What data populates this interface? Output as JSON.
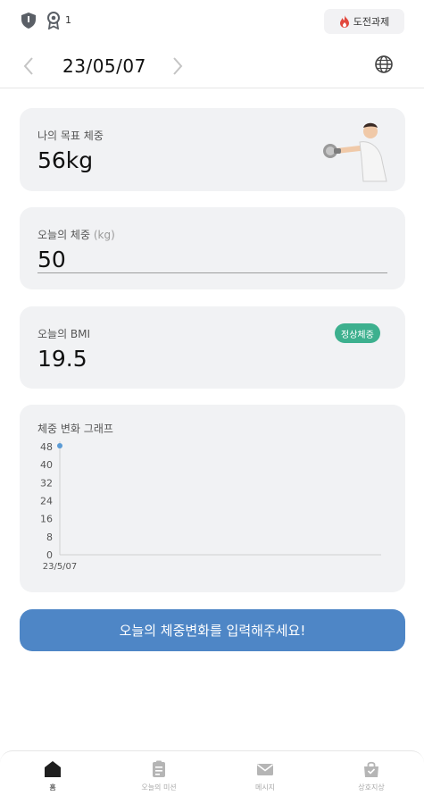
{
  "status_bar": {
    "badge_count": "1",
    "challenge_label": "도전과제"
  },
  "date_nav": {
    "date": "23/05/07"
  },
  "goal_card": {
    "label": "나의 목표 체중",
    "value": "56kg"
  },
  "weight_card": {
    "label": "오늘의 체중",
    "unit": "(kg)",
    "value": "50"
  },
  "bmi_card": {
    "label": "오늘의 BMI",
    "value": "19.5",
    "status": "정상체중"
  },
  "chart_card": {
    "label": "체중 변화 그래프"
  },
  "chart_data": {
    "type": "line",
    "title": "체중 변화 그래프",
    "x": [
      "23/5/07"
    ],
    "series": [
      {
        "values": [
          50
        ]
      }
    ],
    "ylim": [
      0,
      48
    ],
    "yticks": [
      "48",
      "40",
      "32",
      "24",
      "16",
      "8",
      "0"
    ],
    "color": "#5b9bd5"
  },
  "cta": {
    "label": "오늘의 체중변화를 입력해주세요!"
  },
  "tabs": [
    {
      "label": "홈",
      "icon": "home-icon",
      "active": true
    },
    {
      "label": "오늘의 미션",
      "icon": "clipboard-icon",
      "active": false
    },
    {
      "label": "메시지",
      "icon": "mail-icon",
      "active": false
    },
    {
      "label": "상호지상",
      "icon": "bag-icon",
      "active": false
    }
  ],
  "colors": {
    "accent": "#4e86c6",
    "status_green": "#3db08e",
    "card_bg": "#f1f2f4"
  }
}
